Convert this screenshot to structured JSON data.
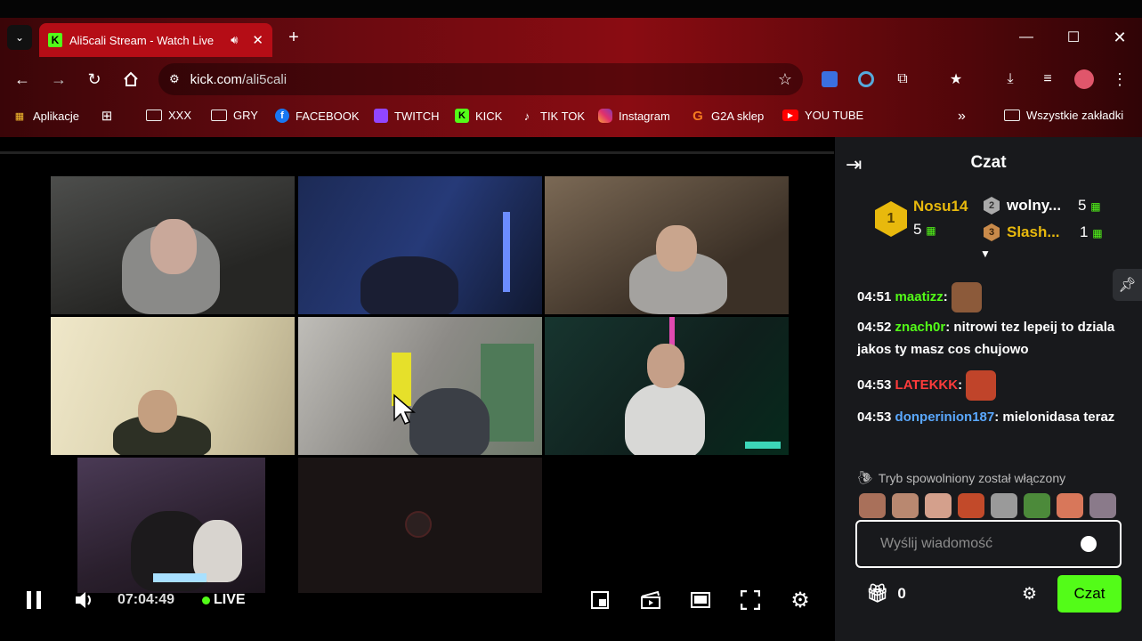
{
  "browser": {
    "tab_title": "Ali5cali Stream - Watch Live",
    "url_host": "kick.com",
    "url_path": "/ali5cali"
  },
  "bookmarks": [
    {
      "label": "Aplikacje"
    },
    {
      "label": "XXX"
    },
    {
      "label": "GRY"
    },
    {
      "label": "FACEBOOK"
    },
    {
      "label": "TWITCH"
    },
    {
      "label": "KICK"
    },
    {
      "label": "TIK TOK"
    },
    {
      "label": "Instagram"
    },
    {
      "label": "G2A sklep"
    },
    {
      "label": "YOU TUBE"
    }
  ],
  "all_bookmarks_label": "Wszystkie zakładki",
  "player": {
    "time": "07:04:49",
    "live_label": "LIVE"
  },
  "chat": {
    "title": "Czat",
    "leaderboard": {
      "first": {
        "rank": "1",
        "name": "Nosu14",
        "count": "5"
      },
      "second": {
        "rank": "2",
        "name": "wolny...",
        "count": "5"
      },
      "third": {
        "rank": "3",
        "name": "Slash...",
        "count": "1"
      }
    },
    "messages": [
      {
        "time": "04:51",
        "user": "maatizz",
        "text": ""
      },
      {
        "time": "04:52",
        "user": "znach0r",
        "text": "nitrowi tez lepeij to dziala jakos ty masz cos chujowo"
      },
      {
        "time": "04:53",
        "user": "LATEKKK",
        "text": ""
      },
      {
        "time": "04:53",
        "user": "donperinion187",
        "text": "mielonidasa teraz"
      }
    ],
    "slow_mode": "Tryb spowolniony został włączony",
    "input_placeholder": "Wyślij wiadomość",
    "points": "0",
    "send_label": "Czat"
  },
  "colors": {
    "kick_green": "#53fc18",
    "chat_bg": "#18191c",
    "latekkk": "#ff3b3b",
    "maatizz": "#53fc18",
    "znach0r": "#53fc18",
    "donperinion187": "#5aa8ff",
    "gold": "#e8b90d"
  }
}
